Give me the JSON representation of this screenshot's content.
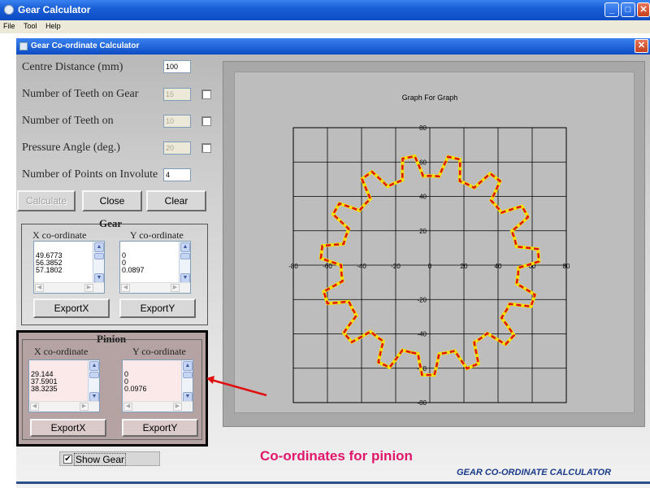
{
  "window": {
    "title": "Gear Calculator"
  },
  "menu": [
    "File",
    "Tool",
    "Help"
  ],
  "child_window": {
    "title": "Gear Co-ordinate Calculator"
  },
  "form": {
    "centre_distance_label": "Centre Distance (mm)",
    "centre_distance_value": "100",
    "teeth_gear_label": "Number of Teeth on Gear",
    "teeth_gear_value": "15",
    "teeth_on_label": "Number of Teeth on",
    "teeth_on_value": "10",
    "pressure_angle_label": "Pressure Angle  (deg.)",
    "pressure_angle_value": "20",
    "points_label": "Number of Points on Involute",
    "points_value": "4"
  },
  "buttons": {
    "calculate": "Calculate",
    "close": "Close",
    "clear": "Clear"
  },
  "gear": {
    "title": "Gear",
    "x_title": "X co-ordinate",
    "y_title": "Y co-ordinate",
    "x_values": [
      "49.6773",
      "56.3852",
      "57.1802"
    ],
    "y_values": [
      "0",
      "0",
      "0.0897"
    ],
    "export_x": "ExportX",
    "export_y": "ExportY"
  },
  "pinion": {
    "title": "Pinion",
    "x_title": "X co-ordinate",
    "y_title": "Y co-ordinate",
    "x_values": [
      "29.144",
      "37.5901",
      "38.3235"
    ],
    "y_values": [
      "0",
      "0",
      "0.0976"
    ],
    "export_x": "ExportX",
    "export_y": "ExportY"
  },
  "show_gear": {
    "label": "Show Gear",
    "checked": true
  },
  "annotation": "Co-ordinates for pinion",
  "footer": "GEAR CO-ORDINATE CALCULATOR",
  "colors": {
    "title_blue": "#1a5fd6",
    "curve_red": "#e01010",
    "curve_yellow": "#f5e000",
    "annotation_pink": "#e0176a"
  },
  "chart_data": {
    "type": "line",
    "title": "Graph For Graph",
    "xlim": [
      -80,
      80
    ],
    "ylim": [
      -80,
      80
    ],
    "x_ticks": [
      -80,
      -60,
      -40,
      -20,
      0,
      20,
      40,
      60,
      80
    ],
    "y_ticks": [
      -80,
      -60,
      -40,
      -20,
      0,
      20,
      40,
      60,
      80
    ],
    "grid": true,
    "gear_profile": {
      "teeth": 15,
      "outer_radius": 64,
      "root_radius": 52
    }
  }
}
